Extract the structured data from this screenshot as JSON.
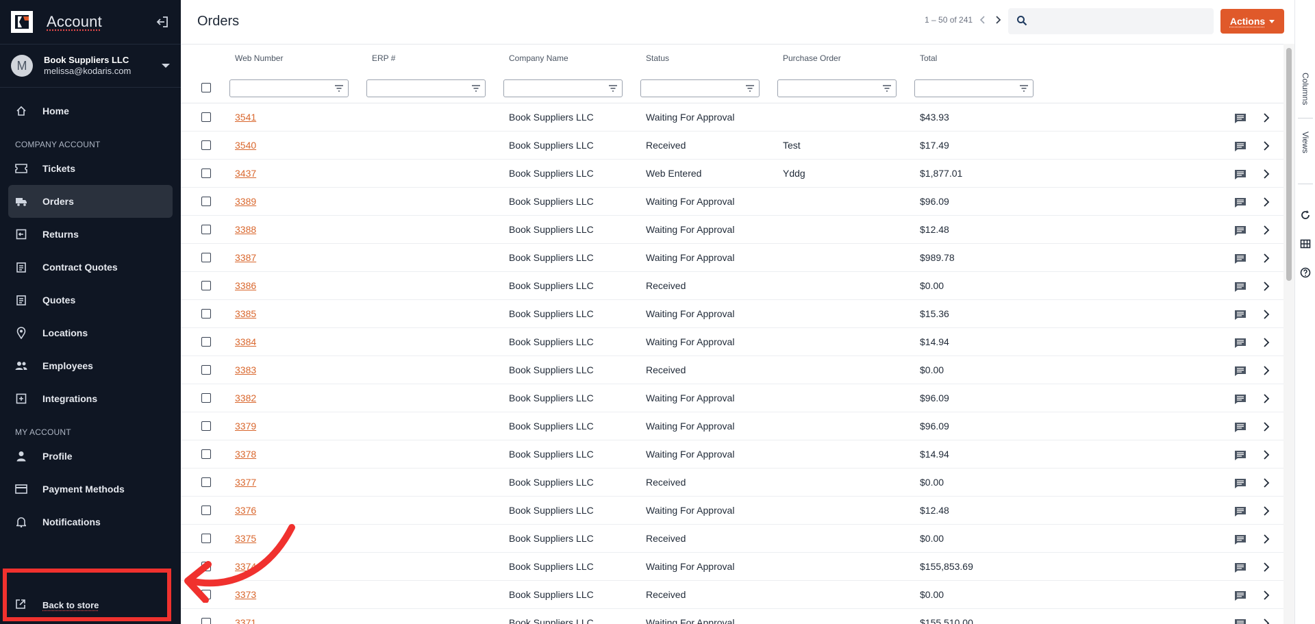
{
  "app": {
    "title": "Account"
  },
  "account": {
    "avatar_letter": "M",
    "name": "Book Suppliers LLC",
    "email": "melissa@kodaris.com"
  },
  "nav": {
    "home": "Home",
    "section_company": "COMPANY ACCOUNT",
    "company_items": [
      "Tickets",
      "Orders",
      "Returns",
      "Contract Quotes",
      "Quotes",
      "Locations",
      "Employees",
      "Integrations"
    ],
    "section_my": "MY ACCOUNT",
    "my_items": [
      "Profile",
      "Payment Methods",
      "Notifications"
    ],
    "back_to_store": "Back to store",
    "active": "Orders"
  },
  "header": {
    "page_title": "Orders",
    "pagination": "1 – 50 of 241",
    "search_placeholder": "",
    "actions_label": "Actions"
  },
  "table": {
    "columns": [
      "Web Number",
      "ERP #",
      "Company Name",
      "Status",
      "Purchase Order",
      "Total"
    ],
    "rows": [
      [
        "3541",
        "",
        "Book Suppliers LLC",
        "Waiting For Approval",
        "",
        "$43.93"
      ],
      [
        "3540",
        "",
        "Book Suppliers LLC",
        "Received",
        "Test",
        "$17.49"
      ],
      [
        "3437",
        "",
        "Book Suppliers LLC",
        "Web Entered",
        "Yddg",
        "$1,877.01"
      ],
      [
        "3389",
        "",
        "Book Suppliers LLC",
        "Waiting For Approval",
        "",
        "$96.09"
      ],
      [
        "3388",
        "",
        "Book Suppliers LLC",
        "Waiting For Approval",
        "",
        "$12.48"
      ],
      [
        "3387",
        "",
        "Book Suppliers LLC",
        "Waiting For Approval",
        "",
        "$989.78"
      ],
      [
        "3386",
        "",
        "Book Suppliers LLC",
        "Received",
        "",
        "$0.00"
      ],
      [
        "3385",
        "",
        "Book Suppliers LLC",
        "Waiting For Approval",
        "",
        "$15.36"
      ],
      [
        "3384",
        "",
        "Book Suppliers LLC",
        "Waiting For Approval",
        "",
        "$14.94"
      ],
      [
        "3383",
        "",
        "Book Suppliers LLC",
        "Received",
        "",
        "$0.00"
      ],
      [
        "3382",
        "",
        "Book Suppliers LLC",
        "Waiting For Approval",
        "",
        "$96.09"
      ],
      [
        "3379",
        "",
        "Book Suppliers LLC",
        "Waiting For Approval",
        "",
        "$96.09"
      ],
      [
        "3378",
        "",
        "Book Suppliers LLC",
        "Waiting For Approval",
        "",
        "$14.94"
      ],
      [
        "3377",
        "",
        "Book Suppliers LLC",
        "Received",
        "",
        "$0.00"
      ],
      [
        "3376",
        "",
        "Book Suppliers LLC",
        "Waiting For Approval",
        "",
        "$12.48"
      ],
      [
        "3375",
        "",
        "Book Suppliers LLC",
        "Received",
        "",
        "$0.00"
      ],
      [
        "3374",
        "",
        "Book Suppliers LLC",
        "Waiting For Approval",
        "",
        "$155,853.69"
      ],
      [
        "3373",
        "",
        "Book Suppliers LLC",
        "Received",
        "",
        "$0.00"
      ],
      [
        "3371",
        "",
        "Book Suppliers LLC",
        "Waiting For Approval",
        "",
        "$155,510.00"
      ]
    ]
  },
  "side_rail": {
    "columns": "Columns",
    "views": "Views"
  },
  "colors": {
    "sidebar_bg": "#0f1623",
    "accent": "#e0592a",
    "link": "#d9662c",
    "annotation": "#f0312e"
  }
}
